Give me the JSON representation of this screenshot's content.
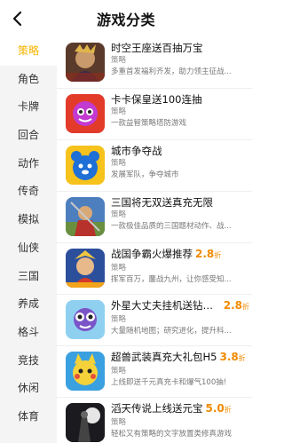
{
  "header": {
    "title": "游戏分类"
  },
  "sidebar": {
    "items": [
      {
        "label": "策略",
        "active": true
      },
      {
        "label": "角色"
      },
      {
        "label": "卡牌"
      },
      {
        "label": "回合"
      },
      {
        "label": "动作"
      },
      {
        "label": "传奇"
      },
      {
        "label": "模拟"
      },
      {
        "label": "仙侠"
      },
      {
        "label": "三国"
      },
      {
        "label": "养成"
      },
      {
        "label": "格斗"
      },
      {
        "label": "竞技"
      },
      {
        "label": "休闲"
      },
      {
        "label": "体育"
      }
    ]
  },
  "games": [
    {
      "name": "时空王座送百抽万宝",
      "tag": "策略",
      "desc": "多重首发福利齐发，助力领主征战...",
      "discount": "",
      "discount_unit": "",
      "icon": "game-icon-throne"
    },
    {
      "name": "卡卡保皇送100连抽",
      "tag": "策略",
      "desc": "一款益智策略塔防游戏",
      "discount": "",
      "discount_unit": "",
      "icon": "game-icon-kaka"
    },
    {
      "name": "城市争夺战",
      "tag": "策略",
      "desc": "发展军队，争夺城市",
      "discount": "",
      "discount_unit": "",
      "icon": "game-icon-city"
    },
    {
      "name": "三国将无双送真充无限",
      "tag": "策略",
      "desc": "一款极佳品质的三国题材动作、战...",
      "discount": "",
      "discount_unit": "",
      "icon": "game-icon-sanguo"
    },
    {
      "name": "战国争霸火爆推荐",
      "tag": "策略",
      "desc": "挥军百万，鏖战九州，让你感受知...",
      "discount": "2.8",
      "discount_unit": "折",
      "icon": "game-icon-warring"
    },
    {
      "name": "外星大丈夫挂机送钻石...",
      "tag": "策略",
      "desc": "大量随机地图；研究进化，提升科...",
      "discount": "2.8",
      "discount_unit": "折",
      "icon": "game-icon-alien"
    },
    {
      "name": "超兽武装真充大礼包H5",
      "tag": "策略",
      "desc": "上线即送千元真充卡和爆气100抽!",
      "discount": "3.8",
      "discount_unit": "折",
      "icon": "game-icon-beast"
    },
    {
      "name": "滔天传说上线送元宝",
      "tag": "策略",
      "desc": "轻松又有策略的文字放置类修真游戏",
      "discount": "5.0",
      "discount_unit": "折",
      "icon": "game-icon-legend"
    }
  ],
  "colors": {
    "accent": "#f5b400",
    "discount": "#f08a00"
  }
}
